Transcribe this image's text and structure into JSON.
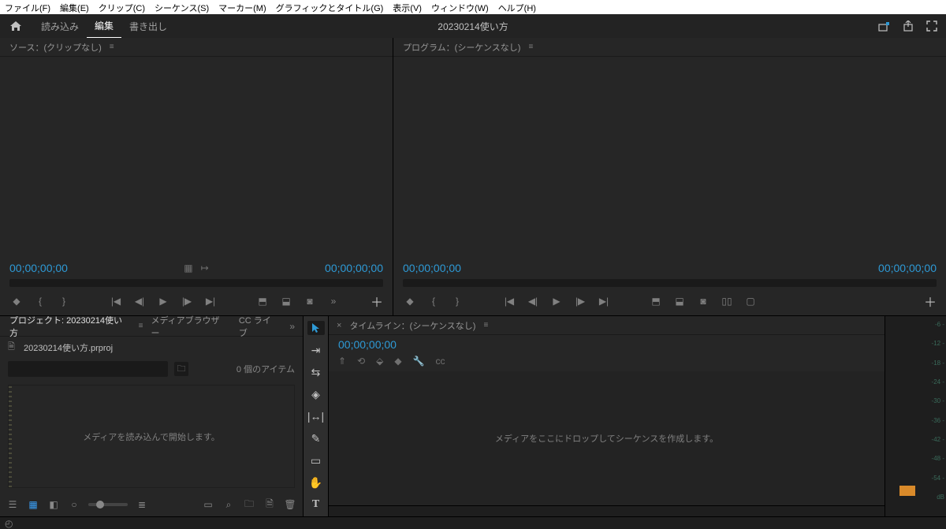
{
  "menu": {
    "file": "ファイル(F)",
    "edit": "編集(E)",
    "clip": "クリップ(C)",
    "sequence": "シーケンス(S)",
    "marker": "マーカー(M)",
    "graphics": "グラフィックとタイトル(G)",
    "view": "表示(V)",
    "window": "ウィンドウ(W)",
    "help": "ヘルプ(H)"
  },
  "workspace": {
    "tabs": {
      "import": "読み込み",
      "edit": "編集",
      "export": "書き出し"
    },
    "project_title": "20230214使い方"
  },
  "source_panel": {
    "tab": "ソース：(クリップなし)",
    "tc_left": "00;00;00;00",
    "tc_right": "00;00;00;00"
  },
  "program_panel": {
    "tab": "プログラム：(シーケンスなし)",
    "tc_left": "00;00;00;00",
    "tc_right": "00;00;00;00"
  },
  "project": {
    "tab_project": "プロジェクト: 20230214使い方",
    "tab_mediabrowser": "メディアブラウザー",
    "tab_cclib": "CC ライブ",
    "bin_name": "20230214使い方.prproj",
    "item_count": "0 個のアイテム",
    "drop_hint": "メディアを読み込んで開始します。"
  },
  "timeline": {
    "tab": "タイムライン：(シーケンスなし)",
    "tc": "00;00;00;00",
    "drop_hint": "メディアをここにドロップしてシーケンスを作成します。"
  },
  "audio_meter": {
    "ticks": [
      "-6 -",
      "-12 -",
      "-18 -",
      "-24 -",
      "-30 -",
      "-36 -",
      "-42 -",
      "-48 -",
      "-54 -",
      "dB"
    ]
  },
  "icons": {
    "close": "×",
    "menu": "≡",
    "chevron": "»"
  }
}
